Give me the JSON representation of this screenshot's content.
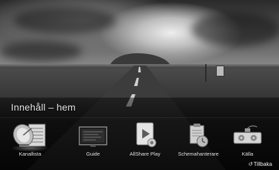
{
  "menu": {
    "title": "Innehåll – hem",
    "items": [
      {
        "label": "Kanallista",
        "icon": "satellite-dish-channel-list-icon"
      },
      {
        "label": "Guide",
        "icon": "tv-guide-icon"
      },
      {
        "label": "AllShare Play",
        "icon": "allshare-play-icon"
      },
      {
        "label": "Schemahanterare",
        "icon": "schedule-manager-icon"
      },
      {
        "label": "Källa",
        "icon": "source-devices-icon"
      }
    ],
    "selected_index": 0
  },
  "footer": {
    "back_icon": "return-arrow-icon",
    "back_label": "Tillbaka"
  }
}
